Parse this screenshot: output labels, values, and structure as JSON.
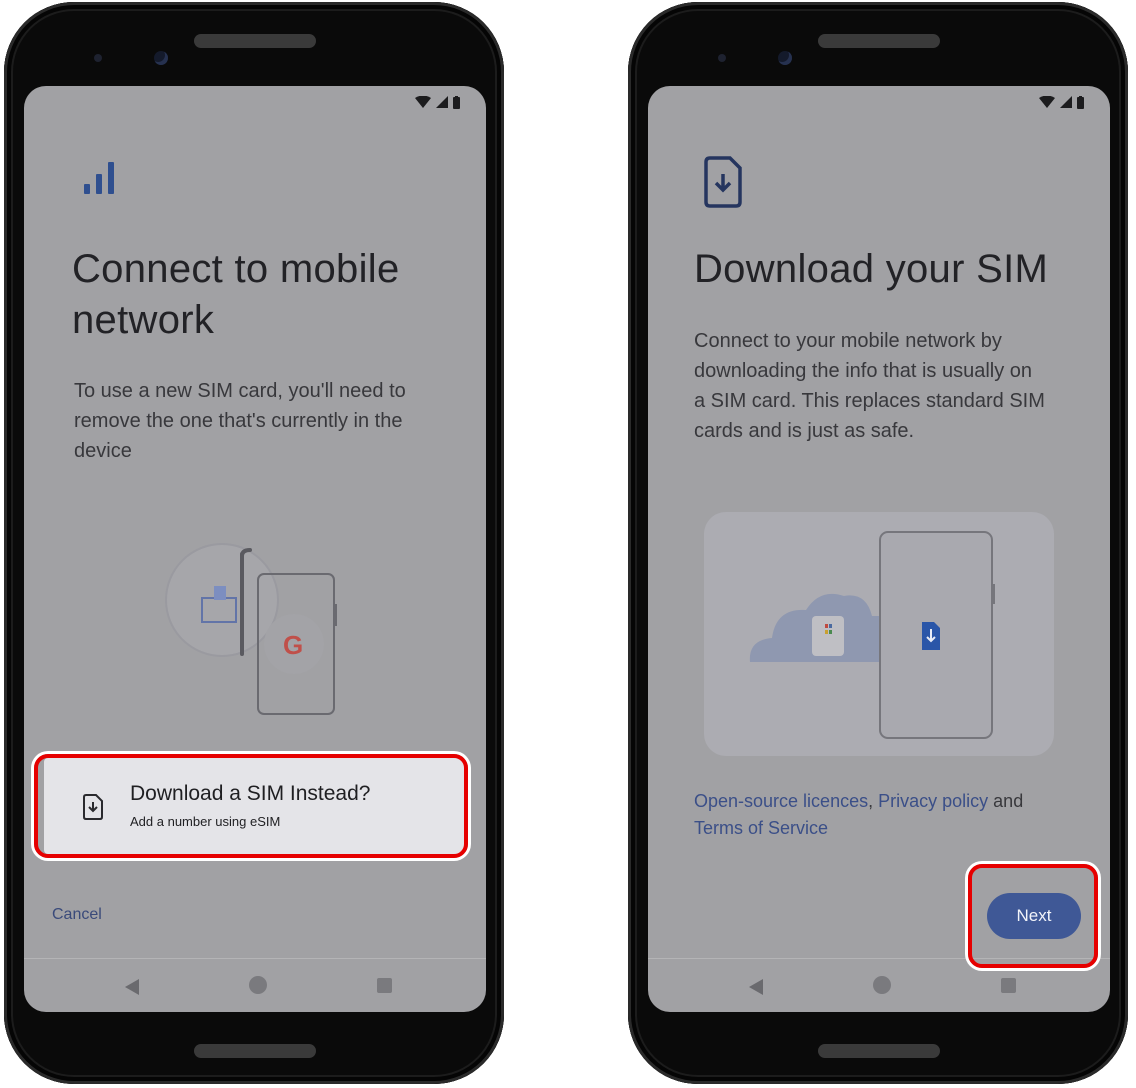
{
  "left_screen": {
    "title_line1": "Connect to mobile",
    "title_line2": "network",
    "description_line1": "To use a new SIM card, you'll need to",
    "description_line2": "remove the one that's currently in the",
    "description_line3": "device",
    "download_option": {
      "title": "Download a SIM Instead?",
      "subtitle": "Add a number using eSIM"
    },
    "cancel_label": "Cancel"
  },
  "right_screen": {
    "title": "Download your SIM",
    "description_line1": "Connect to your mobile network by",
    "description_line2": "downloading the info that is usually on",
    "description_line3": "a SIM card. This replaces standard SIM",
    "description_line4": "cards and is just as safe.",
    "links": {
      "open_source": "Open-source licences",
      "comma": ",",
      "privacy": "Privacy policy",
      "and": "and",
      "terms": "Terms of Service"
    },
    "next_label": "Next"
  },
  "icons": {
    "signal": "signal-bars-icon",
    "esim": "sim-download-icon",
    "wifi": "wifi-icon",
    "cell": "cell-signal-icon",
    "battery": "battery-icon",
    "back": "back-triangle-icon",
    "home": "home-circle-icon",
    "recent": "recents-square-icon"
  },
  "colors": {
    "highlight": "#e60000",
    "accent": "#3f5896",
    "link": "#3b4f88",
    "icon_blue": "#2f4f8f"
  }
}
